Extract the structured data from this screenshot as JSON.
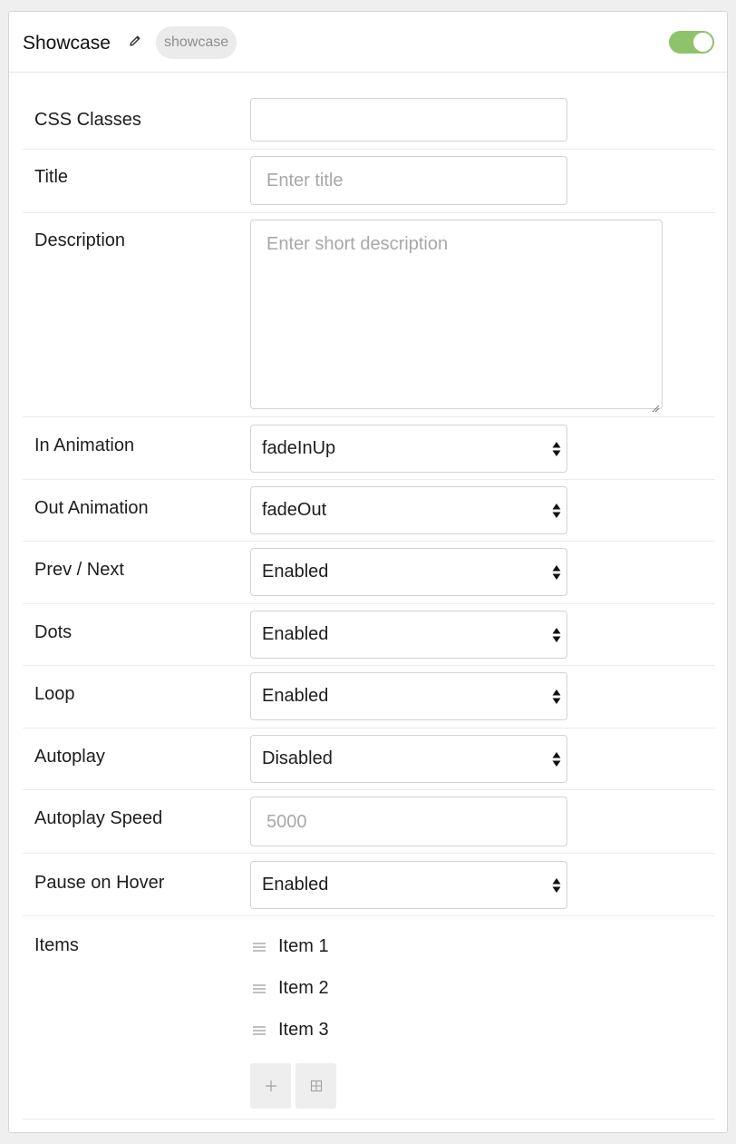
{
  "header": {
    "title": "Showcase",
    "slug": "showcase",
    "enabled": true,
    "accent_color": "#8fc36b"
  },
  "fields": {
    "css_classes": {
      "label": "CSS Classes",
      "value": ""
    },
    "title": {
      "label": "Title",
      "placeholder": "Enter title"
    },
    "description": {
      "label": "Description",
      "placeholder": "Enter short description"
    },
    "in_animation": {
      "label": "In Animation",
      "value": "fadeInUp"
    },
    "out_animation": {
      "label": "Out Animation",
      "value": "fadeOut"
    },
    "prev_next": {
      "label": "Prev / Next",
      "value": "Enabled"
    },
    "dots": {
      "label": "Dots",
      "value": "Enabled"
    },
    "loop": {
      "label": "Loop",
      "value": "Enabled"
    },
    "autoplay": {
      "label": "Autoplay",
      "value": "Disabled"
    },
    "autoplay_speed": {
      "label": "Autoplay Speed",
      "placeholder": "5000"
    },
    "pause_on_hover": {
      "label": "Pause on Hover",
      "value": "Enabled"
    }
  },
  "items": {
    "label": "Items",
    "list": [
      "Item 1",
      "Item 2",
      "Item 3"
    ]
  },
  "icons": {
    "edit": "pencil-icon",
    "handle": "drag-handle-icon",
    "add": "plus-icon",
    "grid": "grid-icon",
    "select_arrows": "sort-arrows-icon"
  }
}
